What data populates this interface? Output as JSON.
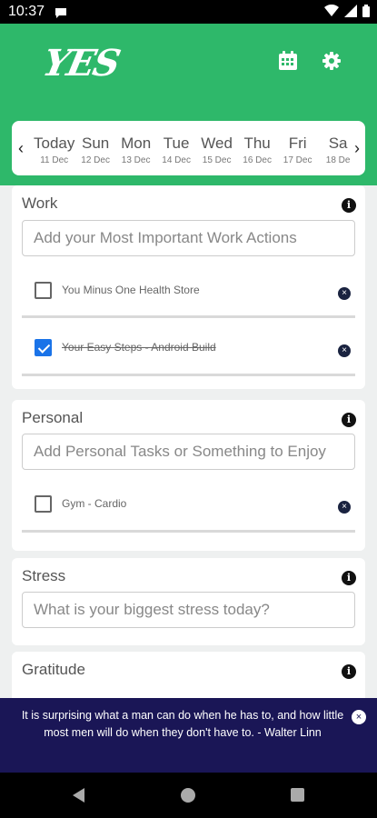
{
  "status": {
    "time": "10:37"
  },
  "app": {
    "logo": "YES"
  },
  "dates": [
    {
      "name": "Today",
      "date": "11 Dec"
    },
    {
      "name": "Sun",
      "date": "12 Dec"
    },
    {
      "name": "Mon",
      "date": "13 Dec"
    },
    {
      "name": "Tue",
      "date": "14 Dec"
    },
    {
      "name": "Wed",
      "date": "15 Dec"
    },
    {
      "name": "Thu",
      "date": "16 Dec"
    },
    {
      "name": "Fri",
      "date": "17 Dec"
    },
    {
      "name": "Sa",
      "date": "18 De"
    }
  ],
  "nav_glyphs": {
    "prev": "‹",
    "next": "›",
    "info": "i",
    "remove": "×"
  },
  "work": {
    "title": "Work",
    "placeholder": "Add your Most Important Work Actions",
    "tasks": [
      {
        "text": "You Minus One Health Store",
        "done": false
      },
      {
        "text": "Your Easy Steps - Android Build",
        "done": true
      }
    ]
  },
  "personal": {
    "title": "Personal",
    "placeholder": "Add Personal Tasks or Something to Enjoy",
    "tasks": [
      {
        "text": "Gym - Cardio",
        "done": false
      }
    ]
  },
  "stress": {
    "title": "Stress",
    "placeholder": "What is your biggest stress today?"
  },
  "gratitude": {
    "title": "Gratitude"
  },
  "quote": {
    "text": "It is surprising what a man can do when he has to, and how little most men will do when they don't have to. - Walter Linn"
  },
  "colors": {
    "header": "#2eb86a",
    "quote_bg": "#1a1656",
    "checkbox": "#1a73e8"
  },
  "icons": {
    "calendar": "calendar-icon",
    "settings": "gear-icon",
    "info": "info-icon",
    "remove": "close-icon"
  }
}
